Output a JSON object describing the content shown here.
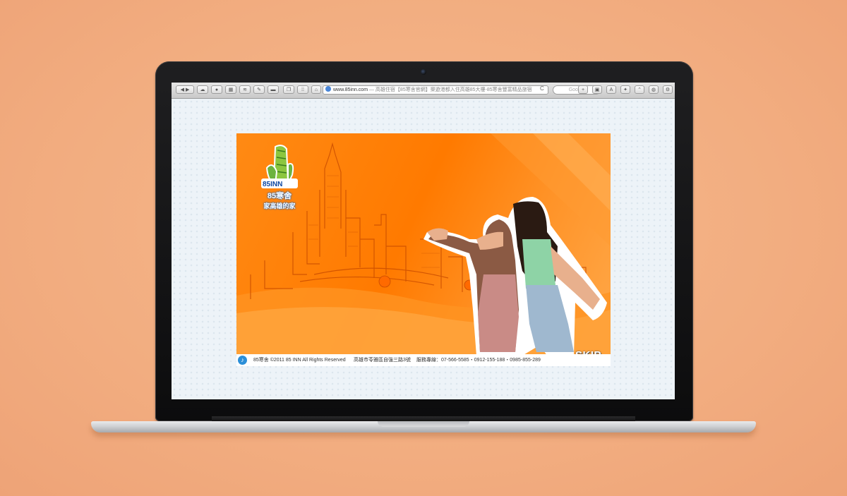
{
  "browser": {
    "back_label": "◀",
    "forward_label": "▶",
    "url": "www.85inn.com",
    "page_title": " — 高雄住宿【85寒舍官網】樂遊港都入住高雄85大樓-85寒舍豐富精品旅宿",
    "search_placeholder": "Google",
    "reload_label": "C"
  },
  "site": {
    "logo_brand": "85INN",
    "logo_name": "85寒舍",
    "logo_slogan": "家高雄的家",
    "copyright": "85寒舍 ©2011 85 INN All Rights Reserved",
    "address": "高雄市苓雅區自強三路3號",
    "phone": "服務專線：07-566-5585・0912-155-188・0985-855-289",
    "skip_label": "SKIP",
    "music_icon": "♪"
  },
  "colors": {
    "banner_orange": "#ff7a00",
    "page_bg": "#edf3f8",
    "backdrop": "#f4b487"
  }
}
